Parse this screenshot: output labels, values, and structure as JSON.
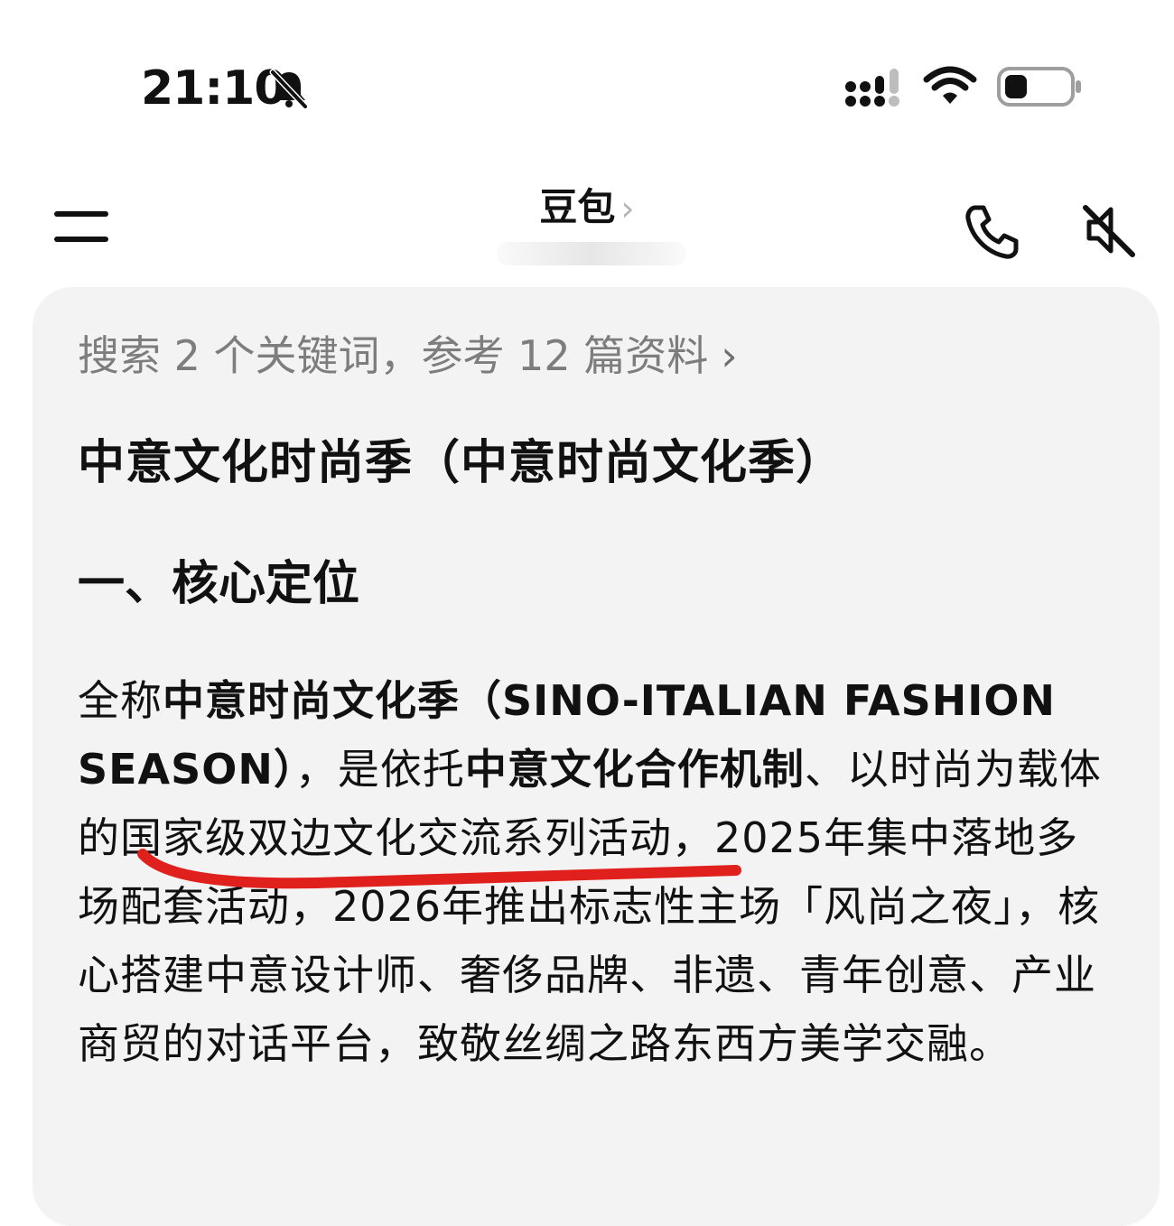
{
  "status_bar": {
    "time": "21:10",
    "icons": [
      "bell-muted-icon",
      "signal-icon",
      "wifi-icon",
      "battery-icon"
    ]
  },
  "nav": {
    "title": "豆包",
    "title_chevron": "›",
    "icons": [
      "menu-icon",
      "phone-icon",
      "speaker-muted-icon"
    ]
  },
  "message": {
    "search_summary": "搜索 2 个关键词，参考 12 篇资料",
    "search_chevron": "›",
    "heading": "中意文化时尚季（中意时尚文化季）",
    "section_title": "一、核心定位",
    "paragraph": {
      "p1": "全称",
      "b1": "中意时尚文化季（SINO-ITALIAN FASHION SEASON）",
      "p2": "，是依托",
      "b2": "中意文化合作机制",
      "p3": "、以时尚为载体的国家级双边文化交流系列活动，2025年集中落地多场配套活动，2026年推出标志性主场「风尚之夜」，核心搭建中意设计师、奢侈品牌、非遗、青年创意、产业商贸的对话平台，致敬丝绸之路东西方美学交融。"
    }
  },
  "colors": {
    "card_background": "#f3f3f3",
    "muted_text": "#7d7d7d",
    "annotation_red": "#e0201c"
  }
}
